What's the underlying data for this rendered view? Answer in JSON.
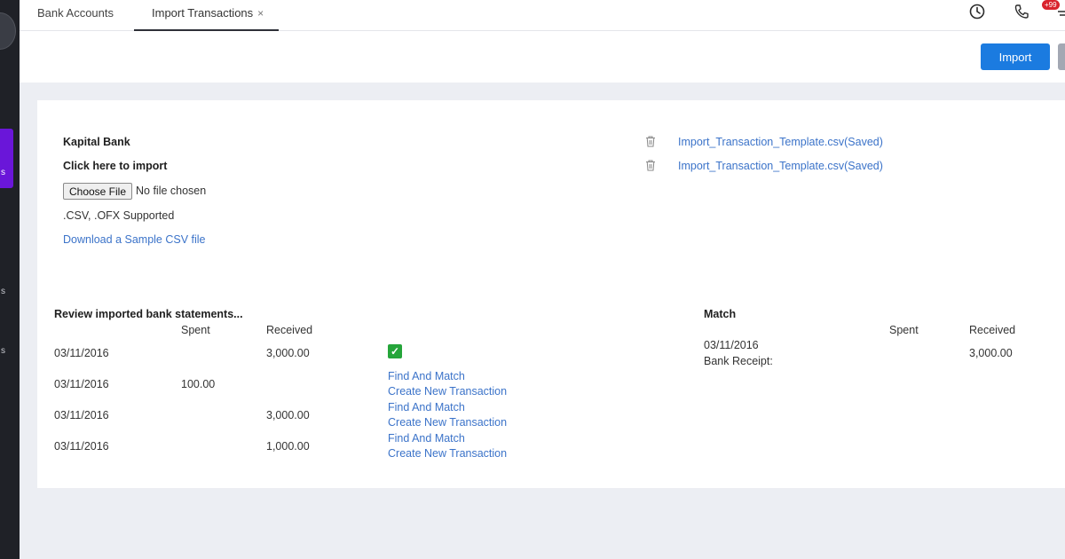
{
  "tabs": {
    "bank_accounts": "Bank Accounts",
    "import_transactions": "Import Transactions",
    "close_glyph": "×"
  },
  "header": {
    "notification_badge": "+99",
    "icons": [
      "clock-icon",
      "phone-icon",
      "notification-icon"
    ]
  },
  "toolbar": {
    "import_label": "Import"
  },
  "sidebar": {
    "fragments": [
      "s",
      "s",
      "s"
    ]
  },
  "import_panel": {
    "bank_name": "Kapital Bank",
    "click_to_import": "Click here to import",
    "choose_file_label": "Choose File",
    "no_file": "No file chosen",
    "supported": ".CSV, .OFX Supported",
    "download_sample": "Download a Sample CSV file",
    "saved_files": [
      "Import_Transaction_Template.csv(Saved)",
      "Import_Transaction_Template.csv(Saved)"
    ]
  },
  "review": {
    "title": "Review imported bank statements...",
    "col_spent": "Spent",
    "col_received": "Received",
    "find_and_match": "Find And Match",
    "create_new": "Create New Transaction",
    "rows": [
      {
        "date": "03/11/2016",
        "spent": "",
        "received": "3,000.00"
      },
      {
        "date": "03/11/2016",
        "spent": "100.00",
        "received": ""
      },
      {
        "date": "03/11/2016",
        "spent": "",
        "received": "3,000.00"
      },
      {
        "date": "03/11/2016",
        "spent": "",
        "received": "1,000.00"
      }
    ]
  },
  "match": {
    "title": "Match",
    "col_spent": "Spent",
    "col_received": "Received",
    "date": "03/11/2016",
    "description": "Bank Receipt:",
    "received": "3,000.00"
  },
  "colors": {
    "primary": "#1b7be0",
    "sidebar_bg": "#1f2127",
    "sidebar_active": "#6a16d9",
    "link": "#3b73c9",
    "match_check": "#25a53a",
    "badge": "#d9232e"
  }
}
